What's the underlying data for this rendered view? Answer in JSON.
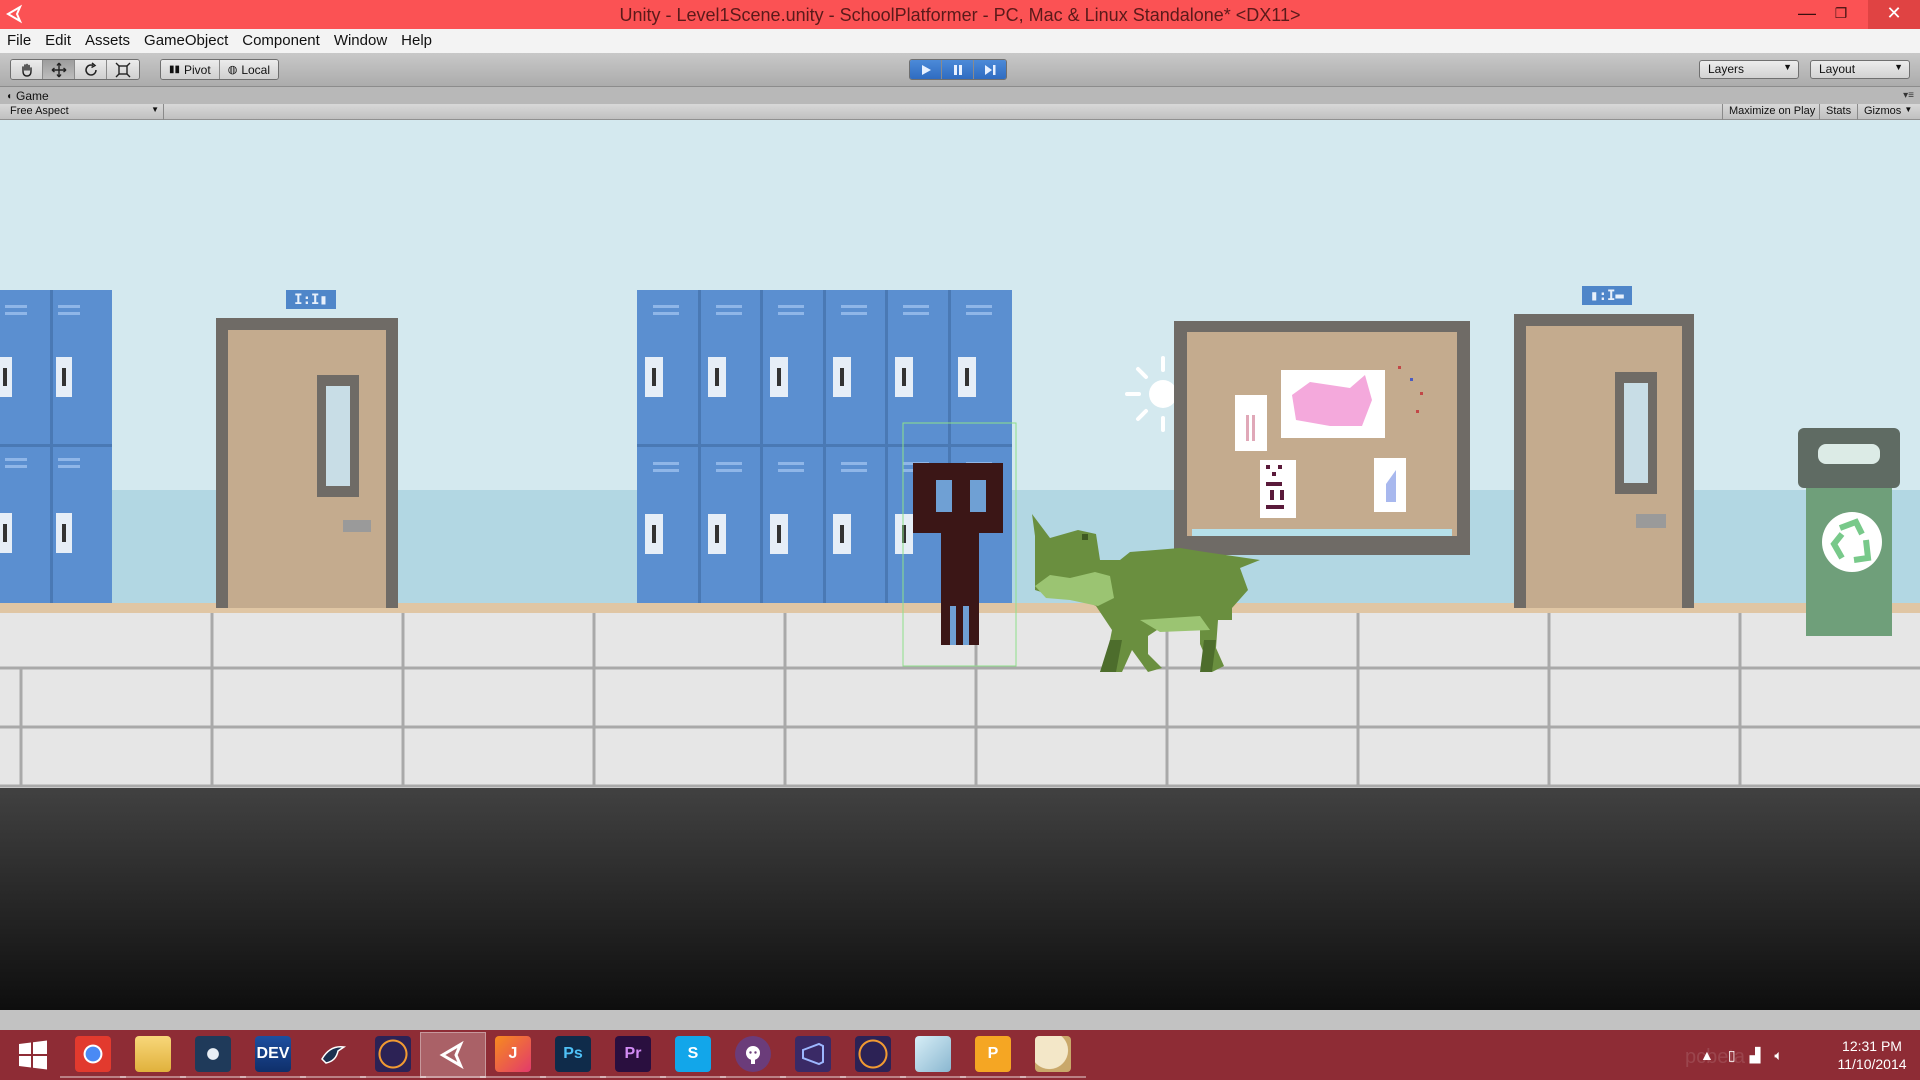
{
  "window": {
    "title": "Unity - Level1Scene.unity - SchoolPlatformer - PC, Mac & Linux Standalone* <DX11>",
    "minimize_glyph": "—",
    "maximize_glyph": "❐",
    "close_glyph": "✕"
  },
  "menu": [
    "File",
    "Edit",
    "Assets",
    "GameObject",
    "Component",
    "Window",
    "Help"
  ],
  "toolbar": {
    "transform_tools": [
      "hand-icon",
      "move-icon",
      "rotate-icon",
      "scale-icon"
    ],
    "pivot_label": "Pivot",
    "local_label": "Local",
    "play_controls": [
      "play-icon",
      "pause-icon",
      "step-icon"
    ],
    "layers_label": "Layers",
    "layout_label": "Layout"
  },
  "game_view": {
    "tab_label": "Game",
    "aspect_label": "Free Aspect",
    "maximize_label": "Maximize on Play",
    "stats_label": "Stats",
    "gizmos_label": "Gizmos",
    "door_left_sign": "I:I▮",
    "door_right_sign": "▮:I▬"
  },
  "taskbar": {
    "apps": [
      {
        "name": "chrome",
        "icon": "chrome-icon"
      },
      {
        "name": "explorer",
        "icon": "folder-icon"
      },
      {
        "name": "steam",
        "icon": "steam-icon"
      },
      {
        "name": "devcpp",
        "icon": "devcpp-icon",
        "label": "DEV"
      },
      {
        "name": "jedit",
        "icon": "bird-icon"
      },
      {
        "name": "eclipse",
        "icon": "eclipse-icon"
      },
      {
        "name": "unity",
        "icon": "unity-icon"
      },
      {
        "name": "intellij",
        "icon": "intellij-icon",
        "label": "J"
      },
      {
        "name": "photoshop",
        "icon": "photoshop-icon",
        "label": "Ps"
      },
      {
        "name": "premiere",
        "icon": "premiere-icon",
        "label": "Pr"
      },
      {
        "name": "skype",
        "icon": "skype-icon",
        "label": "S"
      },
      {
        "name": "github",
        "icon": "github-icon"
      },
      {
        "name": "visualstudio",
        "icon": "vs-icon"
      },
      {
        "name": "eclipse2",
        "icon": "eclipse-icon"
      },
      {
        "name": "notes",
        "icon": "note-icon"
      },
      {
        "name": "pidgin",
        "icon": "p-icon",
        "label": "P"
      },
      {
        "name": "paint",
        "icon": "palette-icon"
      }
    ],
    "time": "12:31 PM",
    "date": "11/10/2014",
    "watermark": "pcbeta"
  },
  "colors": {
    "titlebar": "#fb5254",
    "taskbar": "#8e2c35",
    "sky": "#d4e9ef",
    "locker": "#5b8fd0",
    "player": "#3b1616",
    "dino": "#6a8f3f"
  }
}
